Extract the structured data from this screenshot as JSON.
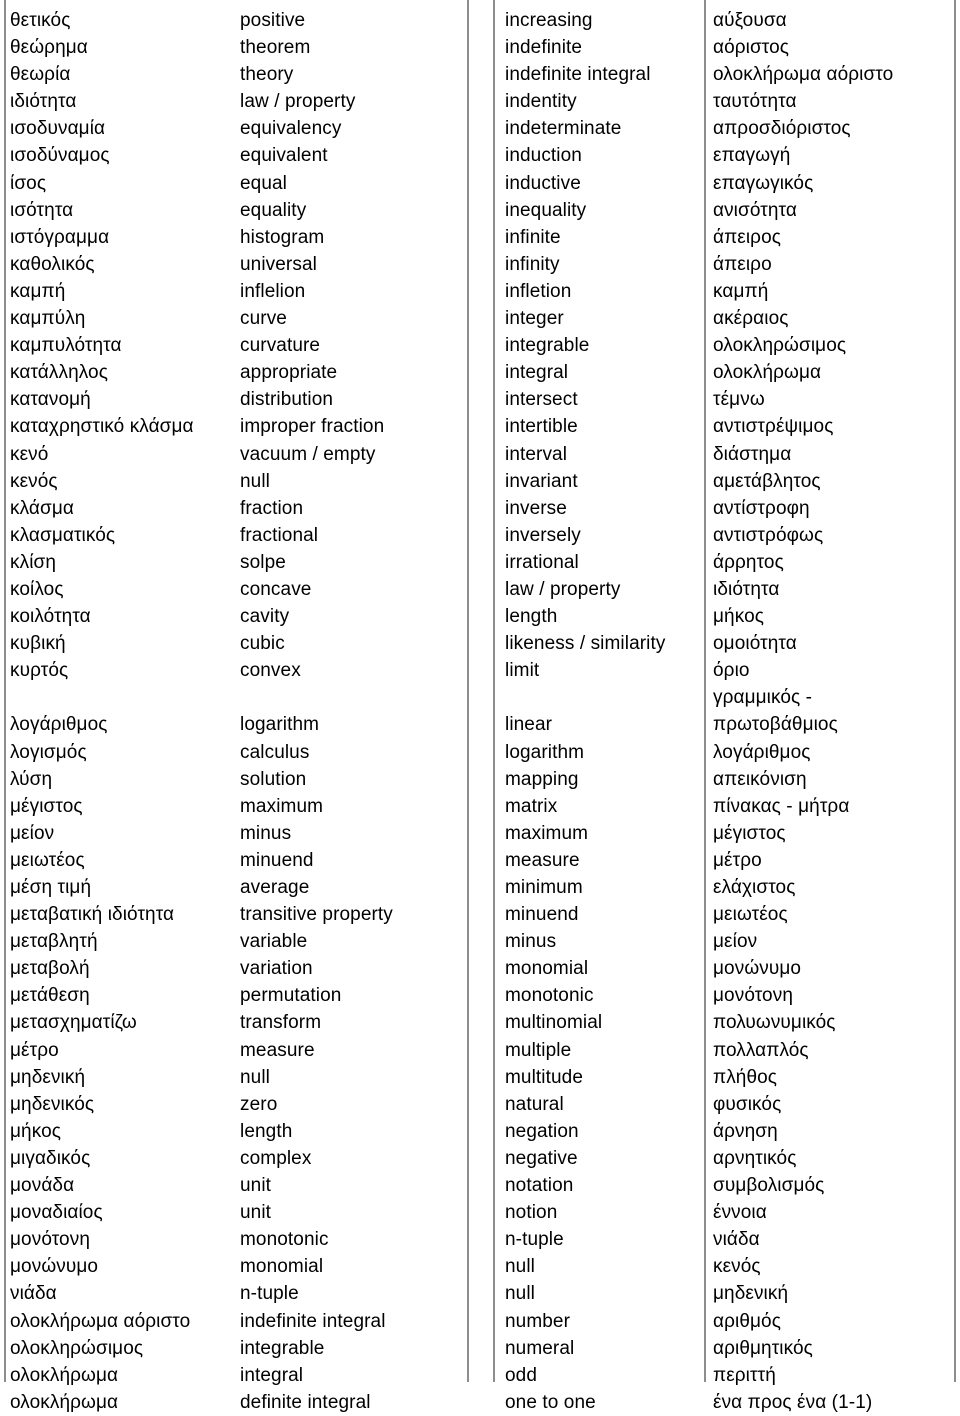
{
  "document": {
    "kind": "bilingual-glossary",
    "title": "Greek – English Mathematical Glossary",
    "columns": 2,
    "rule_color": "#8d8d8d",
    "text_color": "#000000",
    "background_color": "#ffffff"
  },
  "left_panel": {
    "source_language": "Greek",
    "target_language": "English",
    "rows": [
      {
        "term": "θετικός",
        "translation": "positive"
      },
      {
        "term": "θεώρημα",
        "translation": "theorem"
      },
      {
        "term": "θεωρία",
        "translation": "theory"
      },
      {
        "term": "ιδιότητα",
        "translation": "law / property"
      },
      {
        "term": "ισοδυναμία",
        "translation": "equivalency"
      },
      {
        "term": "ισοδύναμος",
        "translation": "equivalent"
      },
      {
        "term": "ίσος",
        "translation": "equal"
      },
      {
        "term": "ισότητα",
        "translation": "equality"
      },
      {
        "term": "ιστόγραμμα",
        "translation": "histogram"
      },
      {
        "term": "καθολικός",
        "translation": "universal"
      },
      {
        "term": "καμπή",
        "translation": "inflelion"
      },
      {
        "term": "καμπύλη",
        "translation": "curve"
      },
      {
        "term": "καμπυλότητα",
        "translation": "curvature"
      },
      {
        "term": "κατάλληλος",
        "translation": "appropriate"
      },
      {
        "term": "κατανομή",
        "translation": "distribution"
      },
      {
        "term": "καταχρηστικό κλάσμα",
        "translation": "improper fraction"
      },
      {
        "term": "κενό",
        "translation": "vacuum / empty"
      },
      {
        "term": "κενός",
        "translation": "null"
      },
      {
        "term": "κλάσμα",
        "translation": "fraction"
      },
      {
        "term": "κλασματικός",
        "translation": "fractional"
      },
      {
        "term": "κλίση",
        "translation": "solpe"
      },
      {
        "term": "κοίλος",
        "translation": "concave"
      },
      {
        "term": "κοιλότητα",
        "translation": "cavity"
      },
      {
        "term": "κυβική",
        "translation": "cubic"
      },
      {
        "term": "κυρτός",
        "translation": "convex"
      },
      {
        "term": "",
        "translation": ""
      },
      {
        "term": "λογάριθμος",
        "translation": "logarithm"
      },
      {
        "term": "λογισμός",
        "translation": "calculus"
      },
      {
        "term": "λύση",
        "translation": "solution"
      },
      {
        "term": "μέγιστος",
        "translation": "maximum"
      },
      {
        "term": "μείον",
        "translation": "minus"
      },
      {
        "term": "μειωτέος",
        "translation": "minuend"
      },
      {
        "term": "μέση τιμή",
        "translation": "average"
      },
      {
        "term": "μεταβατική ιδιότητα",
        "translation": "transitive property"
      },
      {
        "term": "μεταβλητή",
        "translation": "variable"
      },
      {
        "term": "μεταβολή",
        "translation": "variation"
      },
      {
        "term": "μετάθεση",
        "translation": "permutation"
      },
      {
        "term": "μετασχηματίζω",
        "translation": "transform"
      },
      {
        "term": "μέτρο",
        "translation": "measure"
      },
      {
        "term": "μηδενική",
        "translation": "null"
      },
      {
        "term": "μηδενικός",
        "translation": "zero"
      },
      {
        "term": "μήκος",
        "translation": "length"
      },
      {
        "term": "μιγαδικός",
        "translation": "complex"
      },
      {
        "term": "μονάδα",
        "translation": "unit"
      },
      {
        "term": "μοναδιαίος",
        "translation": "unit"
      },
      {
        "term": "μονότονη",
        "translation": "monotonic"
      },
      {
        "term": "μονώνυμο",
        "translation": "monomial"
      },
      {
        "term": "νιάδα",
        "translation": "n-tuple"
      },
      {
        "term": "ολοκλήρωμα αόριστο",
        "translation": "indefinite integral"
      },
      {
        "term": "ολοκληρώσιμος",
        "translation": "integrable"
      },
      {
        "term": "ολοκλήρωμα",
        "translation": "integral"
      },
      {
        "term": "ολοκλήρωμα",
        "translation": "definite integral"
      }
    ]
  },
  "right_panel": {
    "source_language": "English",
    "target_language": "Greek",
    "rows": [
      {
        "term": "increasing",
        "translation": "αύξουσα"
      },
      {
        "term": "indefinite",
        "translation": "αόριστος"
      },
      {
        "term": "indefinite integral",
        "translation": "ολοκλήρωμα αόριστο"
      },
      {
        "term": "indentity",
        "translation": "ταυτότητα"
      },
      {
        "term": "indeterminate",
        "translation": "απροσδιόριστος"
      },
      {
        "term": "induction",
        "translation": "επαγωγή"
      },
      {
        "term": "inductive",
        "translation": "επαγωγικός"
      },
      {
        "term": "inequality",
        "translation": "ανισότητα"
      },
      {
        "term": "infinite",
        "translation": "άπειρος"
      },
      {
        "term": "infinity",
        "translation": "άπειρο"
      },
      {
        "term": "infletion",
        "translation": "καμπή"
      },
      {
        "term": "integer",
        "translation": "ακέραιος"
      },
      {
        "term": "integrable",
        "translation": "ολοκληρώσιμος"
      },
      {
        "term": "integral",
        "translation": "ολοκλήρωμα"
      },
      {
        "term": "intersect",
        "translation": "τέμνω"
      },
      {
        "term": "intertible",
        "translation": "αντιστρέψιμος"
      },
      {
        "term": "interval",
        "translation": "διάστημα"
      },
      {
        "term": "invariant",
        "translation": "αμετάβλητος"
      },
      {
        "term": "inverse",
        "translation": "αντίστροφη"
      },
      {
        "term": "inversely",
        "translation": "αντιστρόφως"
      },
      {
        "term": "irrational",
        "translation": "άρρητος"
      },
      {
        "term": "law / property",
        "translation": "ιδιότητα"
      },
      {
        "term": "length",
        "translation": "μήκος"
      },
      {
        "term": "likeness / similarity",
        "translation": "ομοιότητα"
      },
      {
        "term": "limit",
        "translation": "όριο"
      },
      {
        "term": "",
        "translation": "γραμμικός -"
      },
      {
        "term": "linear",
        "translation": "πρωτοβάθμιος"
      },
      {
        "term": "logarithm",
        "translation": "λογάριθμος"
      },
      {
        "term": "mapping",
        "translation": "απεικόνιση"
      },
      {
        "term": "matrix",
        "translation": "πίνακας - μήτρα"
      },
      {
        "term": "maximum",
        "translation": "μέγιστος"
      },
      {
        "term": "measure",
        "translation": "μέτρο"
      },
      {
        "term": "minimum",
        "translation": "ελάχιστος"
      },
      {
        "term": "minuend",
        "translation": "μειωτέος"
      },
      {
        "term": "minus",
        "translation": "μείον"
      },
      {
        "term": "monomial",
        "translation": "μονώνυμο"
      },
      {
        "term": "monotonic",
        "translation": "μονότονη"
      },
      {
        "term": "multinomial",
        "translation": "πολυωνυμικός"
      },
      {
        "term": "multiple",
        "translation": "πολλαπλός"
      },
      {
        "term": "multitude",
        "translation": "πλήθος"
      },
      {
        "term": "natural",
        "translation": "φυσικός"
      },
      {
        "term": "negation",
        "translation": "άρνηση"
      },
      {
        "term": "negative",
        "translation": "αρνητικός"
      },
      {
        "term": "notation",
        "translation": "συμβολισμός"
      },
      {
        "term": "notion",
        "translation": "έννοια"
      },
      {
        "term": "n-tuple",
        "translation": "νιάδα"
      },
      {
        "term": "null",
        "translation": "κενός"
      },
      {
        "term": "null",
        "translation": "μηδενική"
      },
      {
        "term": "number",
        "translation": "αριθμός"
      },
      {
        "term": "numeral",
        "translation": "αριθμητικός"
      },
      {
        "term": "odd",
        "translation": "περιττή"
      },
      {
        "term": "one to one",
        "translation": "ένα προς ένα (1-1)"
      }
    ]
  }
}
